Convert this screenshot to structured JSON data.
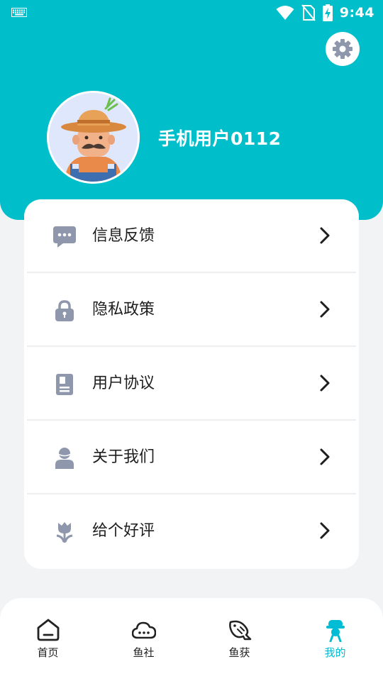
{
  "status_bar": {
    "time": "9:44",
    "left_icon": "keyboard-icon",
    "right_icons": [
      "wifi-icon",
      "no-sim-icon",
      "battery-charging-icon"
    ]
  },
  "header": {
    "settings_icon": "gear-icon",
    "avatar": "farmer-avatar",
    "username": "手机用户0112",
    "background_color": "#00bfcb"
  },
  "menu": {
    "items": [
      {
        "label": "信息反馈",
        "icon": "chat-bubble-icon"
      },
      {
        "label": "隐私政策",
        "icon": "lock-icon"
      },
      {
        "label": "用户协议",
        "icon": "document-icon"
      },
      {
        "label": "关于我们",
        "icon": "person-icon"
      },
      {
        "label": "给个好评",
        "icon": "tulip-icon"
      }
    ],
    "icon_color": "#8e97ab",
    "arrow_icon": "chevron-right-icon"
  },
  "tabbar": {
    "tabs": [
      {
        "label": "首页",
        "icon": "home-icon",
        "active": false
      },
      {
        "label": "鱼社",
        "icon": "cloud-chat-icon",
        "active": false
      },
      {
        "label": "鱼获",
        "icon": "fish-icon",
        "active": false
      },
      {
        "label": "我的",
        "icon": "profile-icon",
        "active": true
      }
    ],
    "active_color": "#00bcd4"
  }
}
